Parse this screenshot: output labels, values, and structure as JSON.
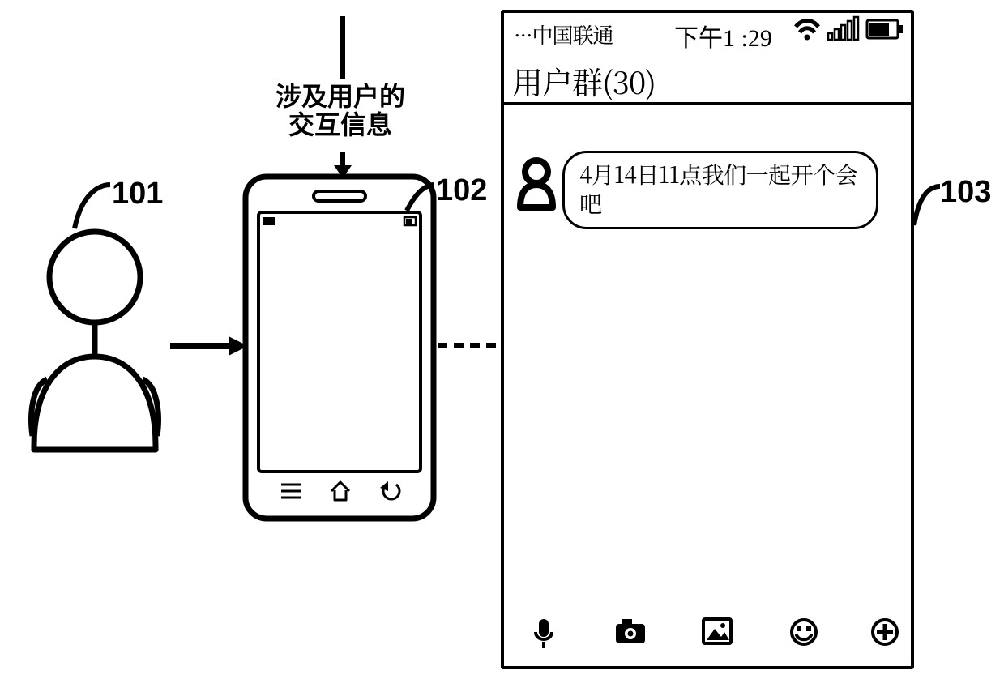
{
  "annotation": {
    "top_label_line1": "涉及用户的",
    "top_label_line2": "交互信息",
    "tag_user": "101",
    "tag_smallphone": "102",
    "tag_bigphone": "103"
  },
  "statusbar": {
    "carrier": "···中国联通",
    "time": "下午1 :29",
    "icons": {
      "wifi": "wifi-icon",
      "signal": "signal-bars-icon",
      "battery": "battery-icon"
    }
  },
  "chat": {
    "group_title": "用户群(30)",
    "message_text": "4月14日11点我们一起开个会吧"
  },
  "toolbar": {
    "items": [
      {
        "name": "voice-icon"
      },
      {
        "name": "camera-icon"
      },
      {
        "name": "picture-icon"
      },
      {
        "name": "emoji-icon"
      },
      {
        "name": "add-icon"
      }
    ]
  },
  "smallphone_nav": {
    "items": [
      {
        "name": "menu-icon"
      },
      {
        "name": "home-icon"
      },
      {
        "name": "back-icon"
      }
    ]
  }
}
